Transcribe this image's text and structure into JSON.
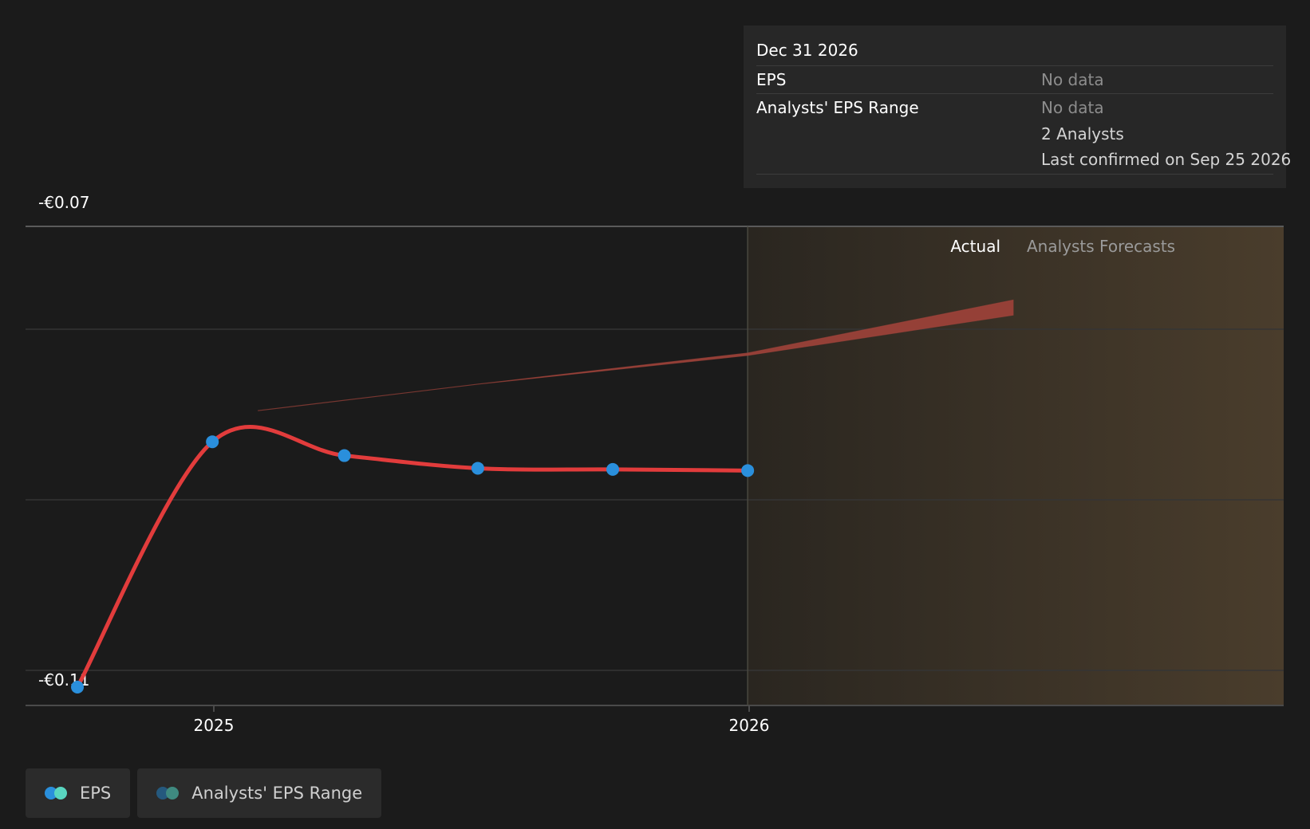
{
  "colors": {
    "background": "#1b1b1b",
    "eps_line": "#e23c3c",
    "eps_point": "#2a8fdc",
    "forecast_band": "#a0433a",
    "forecast_region": "#4a3d2c",
    "legend_eps_dot1": "#2a8fdc",
    "legend_eps_dot2": "#59d6c0",
    "legend_range_dot1": "#25597e",
    "legend_range_dot2": "#3f8a80"
  },
  "tooltip": {
    "date": "Dec 31 2026",
    "rows": [
      {
        "label": "EPS",
        "value": "No data"
      },
      {
        "label": "Analysts' EPS Range",
        "value": "No data"
      }
    ],
    "analysts": "2 Analysts",
    "last_confirmed": "Last confirmed on Sep 25 2026"
  },
  "legend": [
    {
      "label": "EPS",
      "icon": "eps-legend-icon"
    },
    {
      "label": "Analysts' EPS Range",
      "icon": "range-legend-icon"
    }
  ],
  "chart_data": {
    "type": "line",
    "y_tick_labels": [
      "-€0.07",
      "-€0.11"
    ],
    "x_tick_labels": [
      "2025",
      "2026"
    ],
    "ylim": [
      -0.11,
      -0.07
    ],
    "region_labels": {
      "actual": "Actual",
      "forecast": "Analysts Forecasts"
    },
    "grid": true,
    "series": [
      {
        "name": "EPS",
        "x": [
          "2024-09-30",
          "2024-12-31",
          "2025-03-31",
          "2025-06-30",
          "2025-09-30",
          "2025-12-31"
        ],
        "y": [
          -0.11,
          -0.0887,
          -0.0899,
          -0.091,
          -0.0911,
          -0.0912
        ]
      },
      {
        "name": "Analysts' EPS Range",
        "x": [
          "2025-01-31",
          "2025-06-30",
          "2025-12-31",
          "2026-06-30"
        ],
        "low": [
          -0.086,
          -0.0837,
          -0.0812,
          -0.0777
        ],
        "high": [
          -0.086,
          -0.0837,
          -0.081,
          -0.0764
        ]
      }
    ]
  }
}
